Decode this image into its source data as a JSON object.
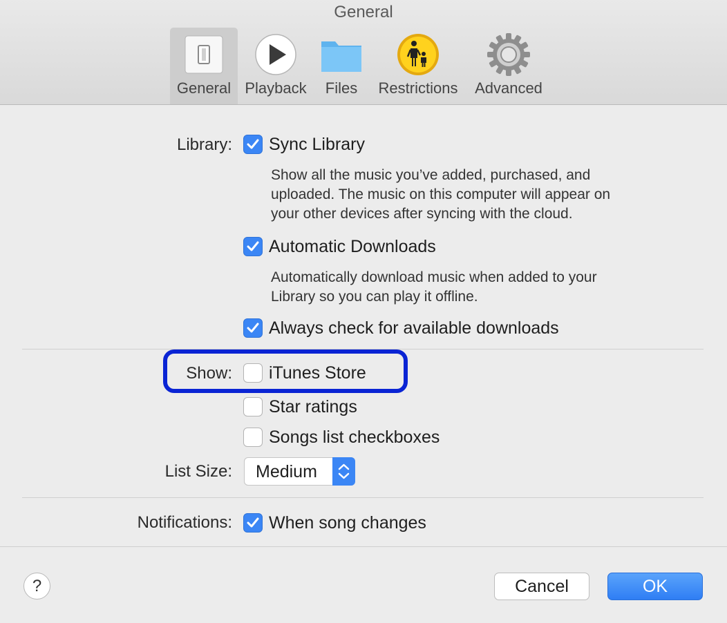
{
  "window": {
    "title": "General"
  },
  "toolbar": {
    "tabs": [
      {
        "label": "General",
        "icon": "switch-icon",
        "selected": true
      },
      {
        "label": "Playback",
        "icon": "play-icon",
        "selected": false
      },
      {
        "label": "Files",
        "icon": "folder-icon",
        "selected": false
      },
      {
        "label": "Restrictions",
        "icon": "parental-icon",
        "selected": false
      },
      {
        "label": "Advanced",
        "icon": "gear-icon",
        "selected": false
      }
    ]
  },
  "library": {
    "label": "Library:",
    "sync": {
      "label": "Sync Library",
      "checked": true
    },
    "sync_desc": [
      "Show all the music you’ve added, purchased, and",
      "uploaded. The music on this computer will appear on",
      "your other devices after syncing with the cloud."
    ],
    "auto_downloads": {
      "label": "Automatic Downloads",
      "checked": true
    },
    "auto_desc": [
      "Automatically download music when added to your",
      "Library so you can play it offline."
    ],
    "always_check": {
      "label": "Always check for available downloads",
      "checked": true
    }
  },
  "show": {
    "label": "Show:",
    "itunes_store": {
      "label": "iTunes Store",
      "checked": false
    },
    "star_ratings": {
      "label": "Star ratings",
      "checked": false
    },
    "songs_checkboxes": {
      "label": "Songs list checkboxes",
      "checked": false
    }
  },
  "list_size": {
    "label": "List Size:",
    "value": "Medium"
  },
  "notifications": {
    "label": "Notifications:",
    "song_changes": {
      "label": "When song changes",
      "checked": true
    }
  },
  "footer": {
    "help": "?",
    "cancel": "Cancel",
    "ok": "OK"
  },
  "colors": {
    "accent": "#3b86f5",
    "highlight": "#0a24d4"
  }
}
